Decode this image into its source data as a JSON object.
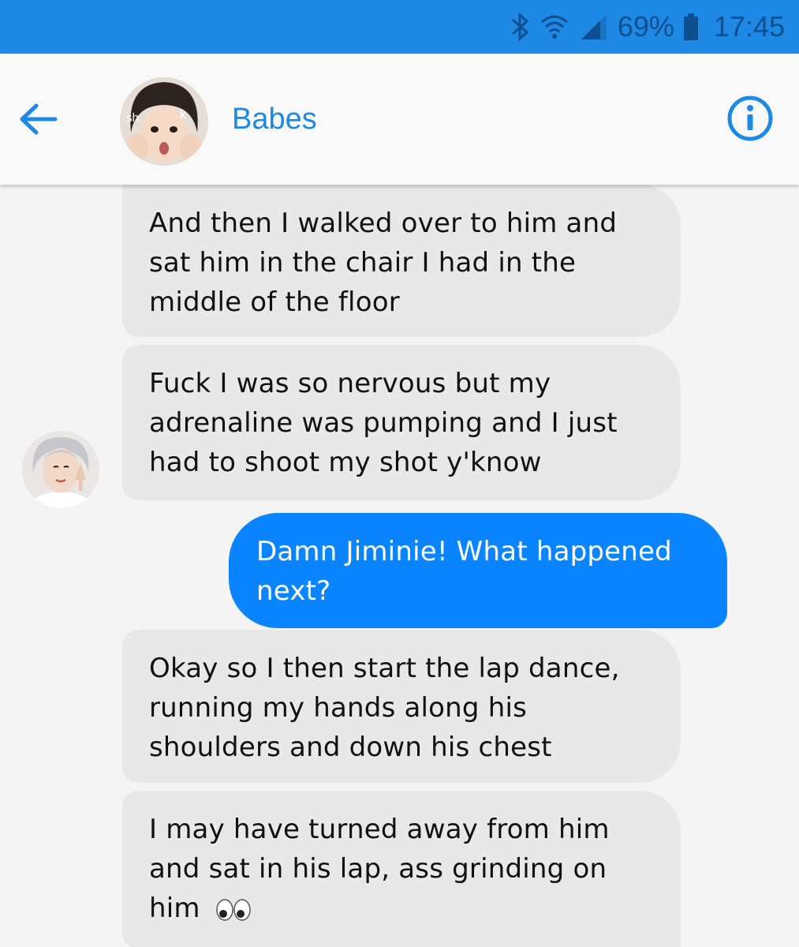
{
  "status_bar": {
    "battery_percent": "69%",
    "time": "17:45",
    "icons": [
      "bluetooth-icon",
      "wifi-icon",
      "signal-icon",
      "battery-icon"
    ]
  },
  "header": {
    "back_icon": "arrow-left-icon",
    "contact_name": "Babes",
    "avatar_overlay_text": "sh    k",
    "info_icon": "info-icon"
  },
  "conversation": {
    "messages": [
      {
        "direction": "received",
        "text": "And then I walked over to him and sat him in the chair I had in the middle of the floor"
      },
      {
        "direction": "received",
        "text": "Fuck I was so nervous but my adrenaline was pumping and I just had to shoot my shot y'know"
      },
      {
        "direction": "sent",
        "text": "Damn Jiminie! What happened next?"
      },
      {
        "direction": "received",
        "text": "Okay so I then start the lap dance, running my hands along his shoulders and down his chest"
      },
      {
        "direction": "received",
        "text": "I may have turned away from him and sat in his lap, ass grinding on him",
        "emoji": "eyes-emoji"
      }
    ]
  },
  "colors": {
    "accent": "#1e88e5",
    "sent_bubble": "#0a84ff",
    "received_bubble": "#e8e8e8",
    "background": "#f4f4f4"
  }
}
